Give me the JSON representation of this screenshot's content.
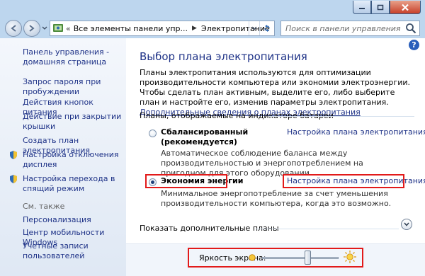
{
  "window": {
    "caption": {
      "minimize_icon": "minimize-icon",
      "maximize_icon": "maximize-icon",
      "close_icon": "close-icon"
    }
  },
  "navbar": {
    "breadcrumb": [
      "Все элементы панели упр...",
      "Электропитание"
    ],
    "search_placeholder": "Поиск в панели управления"
  },
  "sidebar": {
    "home_link": "Панель управления - домашняя страница",
    "links": [
      "Запрос пароля при пробуждении",
      "Действия кнопок питания",
      "Действие при закрытии крышки",
      "Создать план электропитания",
      "Настройка отключения дисплея",
      "Настройка перехода в спящий режим"
    ],
    "see_also": "См. также",
    "see_also_links": [
      "Персонализация",
      "Центр мобильности Windows",
      "Учетные записи пользователей"
    ]
  },
  "main": {
    "help": "?",
    "title": "Выбор плана электропитания",
    "intro_text": "Планы электропитания используются для оптимизации производительности компьютера или экономии электроэнергии. Чтобы сделать план активным, выделите его, либо выберите план и настройте его, изменив параметры электропитания.",
    "intro_link": "Дополнительные сведения о планах электропитания",
    "section_label": "Планы, отображаемые на индикаторе батареи",
    "plans": [
      {
        "name": "Сбалансированный (рекомендуется)",
        "description": "Автоматическое соблюдение баланса между производительностью и энергопотреблением на пригодном для этого оборудовании.",
        "settings_link": "Настройка плана электропитания",
        "selected": false
      },
      {
        "name": "Экономия энергии",
        "description": "Минимальное энергопотребление за счет уменьшения производительности компьютера, когда это возможно.",
        "settings_link": "Настройка плана электропитания",
        "selected": true
      }
    ],
    "show_more": "Показать дополнительные планы",
    "brightness_label": "Яркость экрана:",
    "brightness_level": 0.6
  },
  "colors": {
    "link": "#1e3287",
    "highlight_box": "#e21a1a",
    "chrome": "#bdd6ee"
  }
}
